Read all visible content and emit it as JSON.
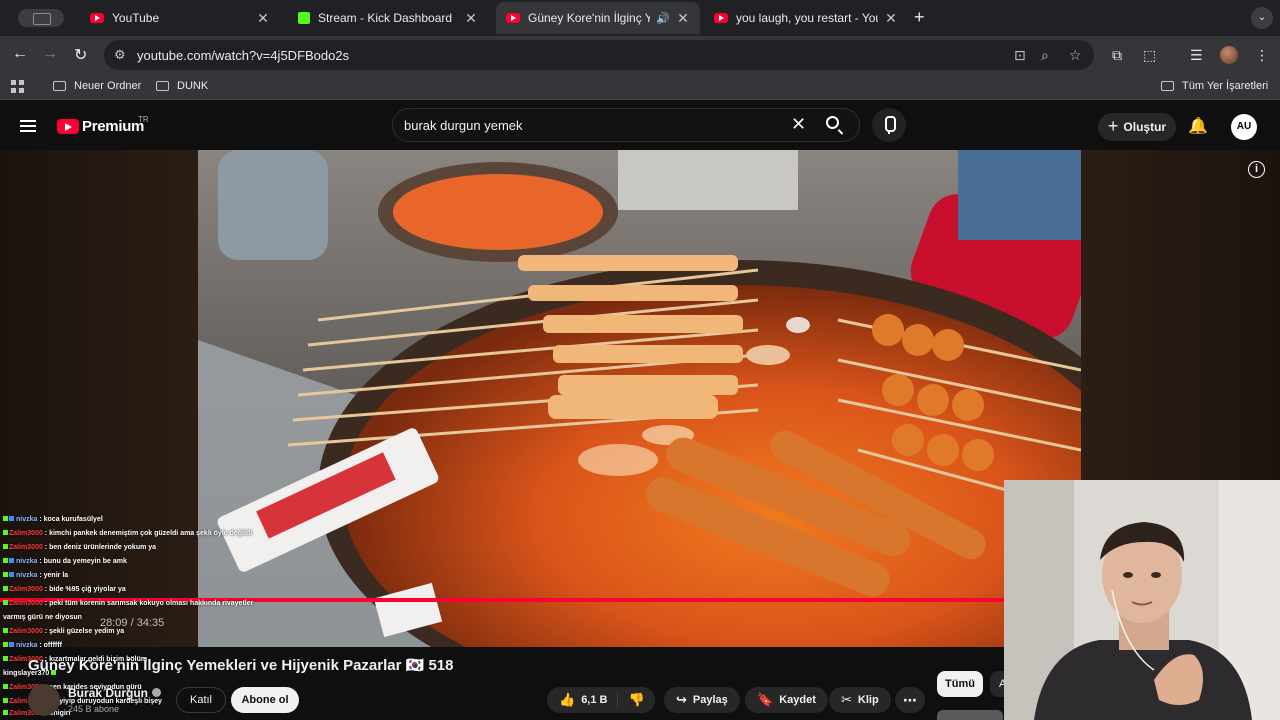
{
  "browser": {
    "tabs": [
      {
        "title": "YouTube",
        "icon": "youtube-icon",
        "active": false
      },
      {
        "title": "Stream - Kick Dashboard",
        "icon": "kick-icon",
        "active": false
      },
      {
        "title": "Güney Kore'nin İlginç Yem",
        "icon": "youtube-icon",
        "active": true
      },
      {
        "title": "you laugh, you restart - YouTu",
        "icon": "youtube-icon",
        "active": false
      }
    ],
    "url": "youtube.com/watch?v=4j5DFBodo2s",
    "bookmarks": [
      {
        "label": "Neuer Ordner"
      },
      {
        "label": "DUNK"
      }
    ],
    "all_bookmarks_label": "Tüm Yer İşaretleri"
  },
  "youtube": {
    "brand": "Premium",
    "region": "TR",
    "search_query": "burak durgun yemek",
    "create_label": "Oluştur",
    "avatar_initials": "AU"
  },
  "video": {
    "time": "28:09 / 34:35",
    "progress": 0.81,
    "title": "Güney Kore'nin İlginç Yemekleri ve Hijyenik Pazarlar 🇰🇷 518",
    "channel": "Burak Durgun",
    "subscribers": "245 B abone",
    "join_label": "Katıl",
    "subscribe_label": "Abone ol",
    "likes": "6,1 B",
    "share_label": "Paylaş",
    "save_label": "Kaydet",
    "clip_label": "Klip",
    "chip_all": "Tümü",
    "chip_next": "A"
  },
  "chat": [
    {
      "user": "nivzka",
      "user_color": "blue",
      "message": "koca kurufasülyel"
    },
    {
      "user": "Zalim3000",
      "user_color": "red",
      "message": "kimchi pankek denemiştim çok güzeldi ama şekli öyle değildi"
    },
    {
      "user": "Zalim3000",
      "user_color": "red",
      "message": "ben deniz ürünlerinde yokum ya"
    },
    {
      "user": "nivzka",
      "user_color": "blue",
      "message": "bunu da yemeyin be amk"
    },
    {
      "user": "nivzka",
      "user_color": "blue",
      "message": "yenir la"
    },
    {
      "user": "Zalim3000",
      "user_color": "red",
      "message": "bide %95 çiğ yiyolar ya"
    },
    {
      "user": "Zalim3000",
      "user_color": "red",
      "message": "peki tüm korenin sarımsak kokuyo olması hakkında rivayetler varmış gürü ne diyosun"
    },
    {
      "user": "Zalim3000",
      "user_color": "red",
      "message": "şekli güzelse yedim ya"
    },
    {
      "user": "nivzka",
      "user_color": "blue",
      "message": "offffff"
    },
    {
      "user": "Zalim3000",
      "user_color": "red",
      "message": "kızartmalar geldi bizim bölüm"
    },
    {
      "user": "kingslayer370",
      "user_color": "white",
      "message": ""
    },
    {
      "user": "Zalim3000",
      "user_color": "red",
      "message": "sen karides seviyodun gürü"
    },
    {
      "user": "Zalim3000",
      "user_color": "red",
      "message": "ne yiyip duruyodun kardeşli bişey"
    },
    {
      "user": "Zalim3000",
      "user_color": "red",
      "message": "onigiri"
    }
  ],
  "colors": {
    "accent": "#ff0033",
    "background": "#0f0f0f",
    "pill": "#272727",
    "kick_green": "#53fc18"
  }
}
